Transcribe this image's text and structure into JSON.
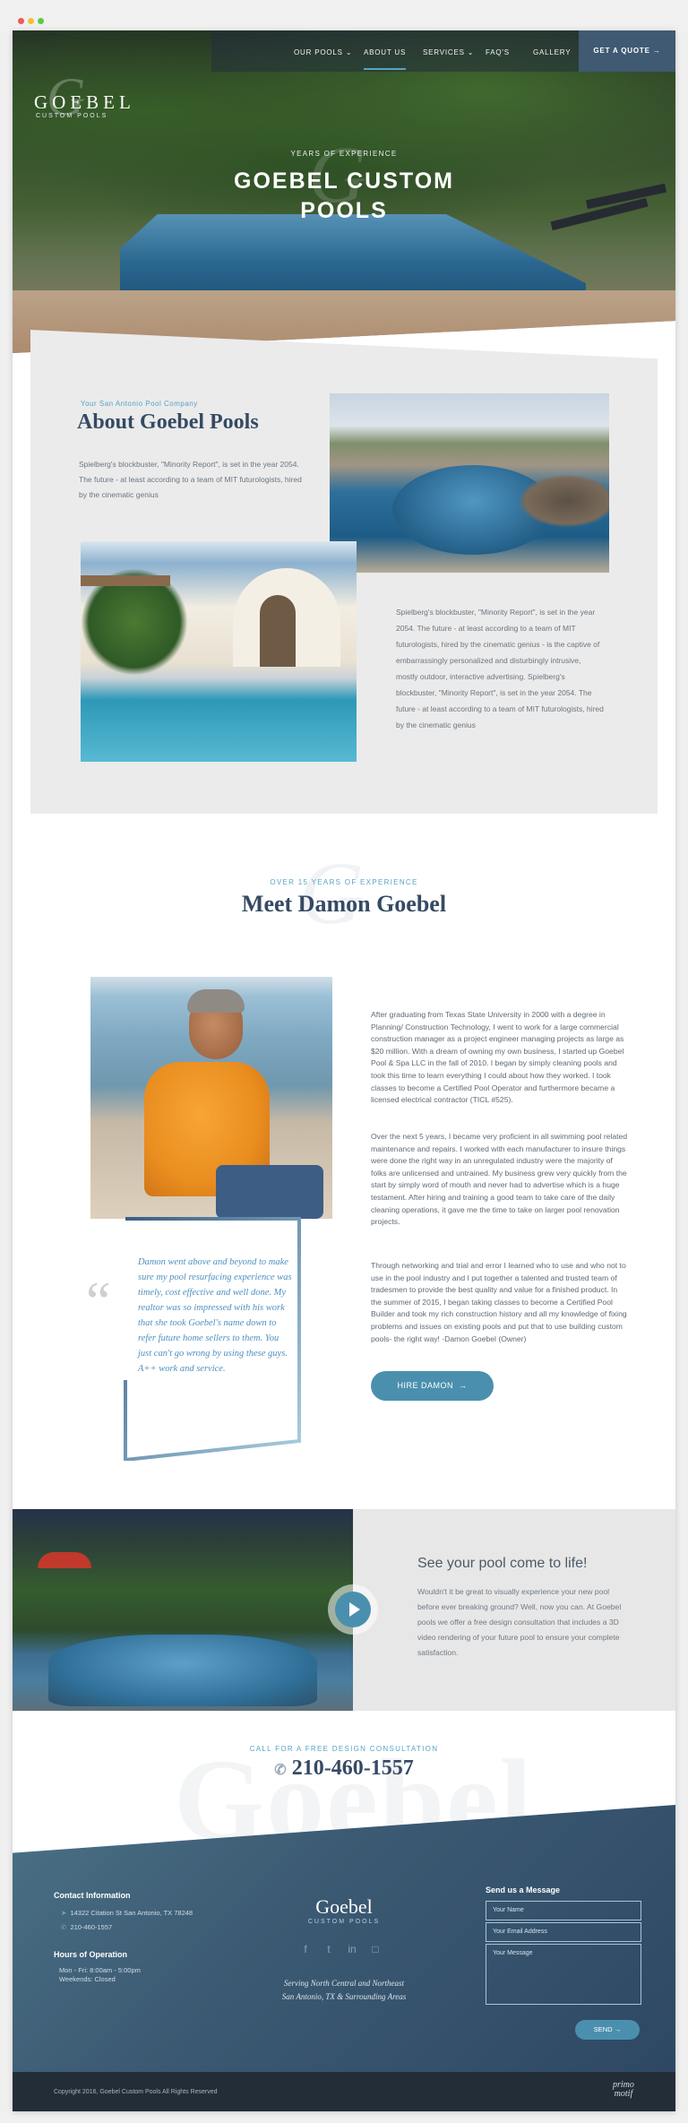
{
  "nav": {
    "items": [
      "OUR POOLS",
      "ABOUT US",
      "SERVICES",
      "FAQ'S",
      "GALLERY"
    ],
    "cta": "GET A QUOTE"
  },
  "logo": {
    "word": "GOEBEL",
    "sub": "CUSTOM POOLS"
  },
  "hero": {
    "kicker": "YEARS OF EXPERIENCE",
    "title_line1": "GOEBEL CUSTOM",
    "title_line2": "POOLS"
  },
  "about": {
    "kicker": "Your San Antonio Pool Company",
    "title": "About Goebel Pools",
    "p1": "Spielberg's blockbuster, \"Minority Report\", is set in the year 2054. The future - at least according to a team of MIT futurologists, hired by the cinematic genius",
    "p2": "Spielberg's blockbuster, \"Minority Report\", is set in the year 2054. The future - at least according to a team of MIT futurologists, hired by the cinematic genius - is the captive of embarrassingly personalized and disturbingly intrusive, mostly outdoor, interactive advertising. Spielberg's blockbuster, \"Minority Report\", is set in the year 2054. The future - at least according to a team of MIT futurologists, hired by the cinematic genius"
  },
  "meet": {
    "kicker": "OVER 15 YEARS OF EXPERIENCE",
    "title": "Meet Damon Goebel",
    "quote": "Damon went above and beyond to make sure my pool resurfacing experience was timely, cost effective and well done. My realtor was so impressed with his work that she took Goebel's name down to refer future home sellers to them. You just can't go wrong by using these guys. A++ work and service.",
    "bio1": "After graduating from Texas State University in 2000 with a degree in Planning/ Construction Technology, I went to work for a large commercial construction manager as a project engineer managing projects as large as $20 million. With a dream of owning my own business, I started up Goebel Pool & Spa LLC in the fall of 2010. I began by simply cleaning pools and took this time to learn everything I could about how they worked. I took classes to become a Certified Pool Operator and furthermore became a licensed electrical contractor (TICL #525).",
    "bio2": "Over the next 5 years, I became very proficient in all swimming pool related maintenance and repairs. I worked with each manufacturer to insure things were done the right way in an unregulated industry were the majority of folks are unlicensed and untrained. My business grew very quickly from the start by simply word of mouth and never had to advertise which is a huge testament. After hiring and training a good team to take care of the daily cleaning operations, it gave me the time to take on larger pool renovation projects.",
    "bio3": "Through networking and trial and error I learned who to use and who not to use in the pool industry and I put together a talented and trusted team of tradesmen to provide the best quality and value for a finished product. In the summer of 2015, I began taking classes to become a Certified Pool Builder and took my rich construction history and all my knowledge of fixing problems and issues on existing pools and put that to use building custom pools- the right way! -Damon Goebel (Owner)",
    "hire": "HIRE DAMON"
  },
  "video": {
    "title": "See your pool come to life!",
    "text": "Wouldn't it be great to visually experience your new pool before ever breaking ground? Well, now you can. At Goebel pools we offer a free design consultation that includes a 3D video rendering of your future pool to ensure your complete satisfaction."
  },
  "call": {
    "kicker": "CALL FOR A FREE DESIGN CONSULTATION",
    "phone": "210-460-1557"
  },
  "footer": {
    "contact_head": "Contact Information",
    "address": "14322 Citation St San Antonio, TX 78248",
    "phone": "210-460-1557",
    "hours_head": "Hours of Operation",
    "hours1": "Mon - Fri:   8:00am - 5:00pm",
    "hours2": "Weekends:   Closed",
    "logo": "Goebel",
    "logo_sub": "CUSTOM POOLS",
    "serve1": "Serving North Central and Northeast",
    "serve2": "San Antonio, TX & Surrounding Areas",
    "msg_head": "Send us a Message",
    "name_ph": "Your Name",
    "email_ph": "Your Email Address",
    "msg_ph": "Your Message",
    "send": "SEND",
    "copyright": "Copyright 2016, Goebel Custom Pools All Rights Reserved",
    "brand1": "primo",
    "brand2": "motif"
  },
  "icons": [
    "search-icon",
    "chevron-down-icon",
    "arrow-right-icon",
    "play-icon",
    "phone-icon",
    "location-icon",
    "facebook-icon",
    "twitter-icon",
    "linkedin-icon",
    "instagram-icon",
    "quote-icon"
  ],
  "colors": {
    "accent": "#4a90ae",
    "navy": "#354a63",
    "footer": "#3c5a73",
    "bar": "#232d38"
  }
}
